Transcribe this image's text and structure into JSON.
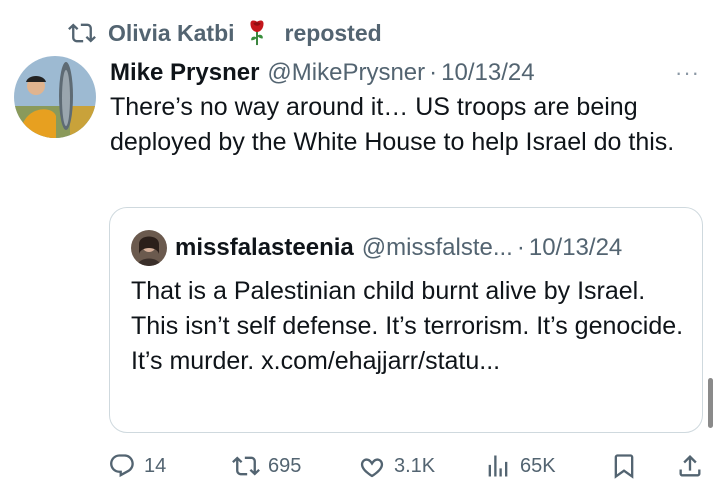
{
  "repost": {
    "user": "Olivia Katbi",
    "emoji": "🌹",
    "label": "reposted"
  },
  "tweet": {
    "name": "Mike Prysner",
    "handle": "@MikePrysner",
    "separator": "·",
    "date": "10/13/24",
    "more": "···",
    "text": "There’s no way around it… US troops are being deployed by the White House to help Israel do this."
  },
  "quote": {
    "name": "missfalasteenia",
    "handle": "@missfalste...",
    "separator": "·",
    "date": "10/13/24",
    "text": "That is a Palestinian child burnt alive by Israel. This isn’t self defense. It’s terrorism. It’s genocide. It’s murder. x.com/ehajjarr/statu..."
  },
  "actions": {
    "replies": "14",
    "reposts": "695",
    "likes": "3.1K",
    "views": "65K"
  },
  "icons": [
    "repost-icon",
    "rose-emoji",
    "reply-icon",
    "like-icon",
    "views-icon",
    "bookmark-icon",
    "share-icon"
  ],
  "colors": {
    "text": "#0f1419",
    "secondary": "#536471",
    "border": "#cfd9de",
    "rose": "#c4161c"
  }
}
